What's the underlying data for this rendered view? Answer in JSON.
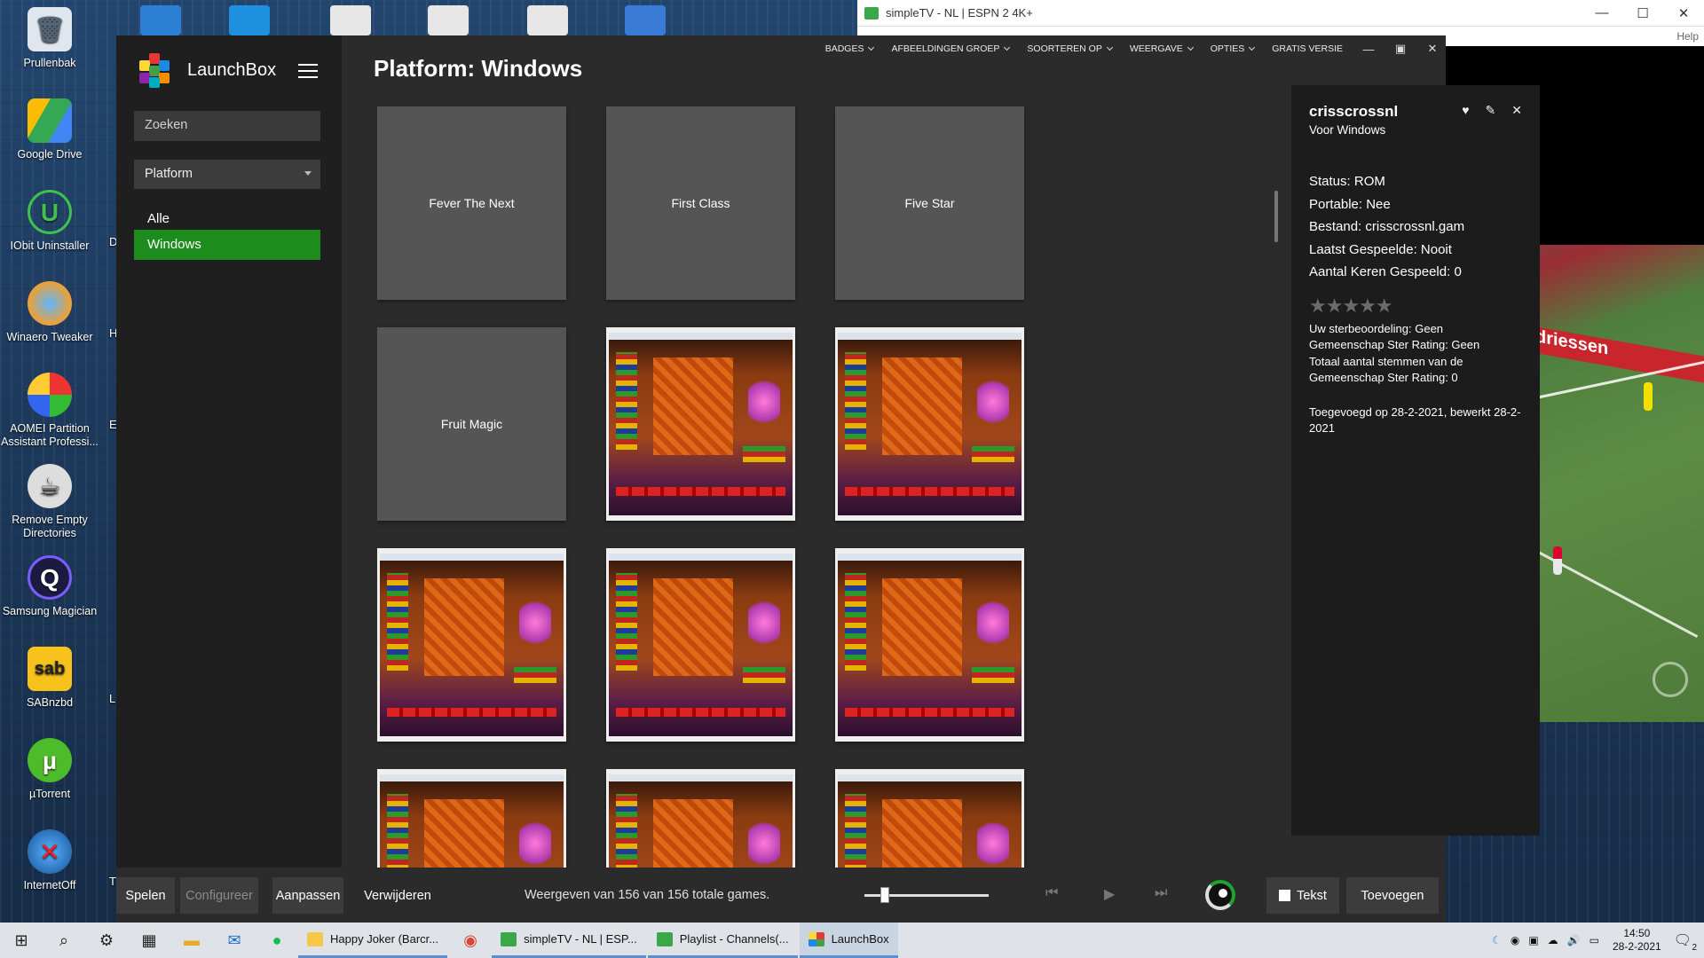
{
  "desktop": {
    "icons": [
      {
        "label": "Prullenbak",
        "icon": "recycle-bin-icon"
      },
      {
        "label": "Google Drive",
        "icon": "google-drive-icon"
      },
      {
        "label": "IObit Uninstaller",
        "icon": "iobit-uninstaller-icon"
      },
      {
        "label": "Winaero Tweaker",
        "icon": "winaero-tweaker-icon"
      },
      {
        "label": "AOMEI Partition Assistant Professi...",
        "icon": "aomei-partition-icon"
      },
      {
        "label": "Remove Empty Directories",
        "icon": "remove-empty-dirs-icon"
      },
      {
        "label": "Samsung Magician",
        "icon": "samsung-magician-icon"
      },
      {
        "label": "SABnzbd",
        "icon": "sabnzbd-icon"
      },
      {
        "label": "µTorrent",
        "icon": "utorrent-icon"
      },
      {
        "label": "InternetOff",
        "icon": "internetoff-icon"
      }
    ],
    "col2_letters": [
      "D",
      "H",
      "E",
      "L",
      "T"
    ]
  },
  "simpletv": {
    "title": "simpleTV - NL | ESPN 2 4K+",
    "menu_help": "Help",
    "pitch_banner": "driessen",
    "colors": {
      "pitch": "#5d8c44",
      "banner": "#c8262d"
    }
  },
  "launchbox": {
    "app_name": "LaunchBox",
    "search_placeholder": "Zoeken",
    "platform_select": "Platform",
    "sidebar_items": [
      "Alle",
      "Windows"
    ],
    "active_item": "Windows",
    "menu": [
      "BADGES",
      "AFBEELDINGEN GROEP",
      "SOORTEREN OP",
      "WEERGAVE",
      "OPTIES"
    ],
    "free_version": "GRATIS VERSIE",
    "page_title": "Platform: Windows",
    "tiles": [
      {
        "label": "Fever The Next",
        "type": "text"
      },
      {
        "label": "First Class",
        "type": "text"
      },
      {
        "label": "Five Star",
        "type": "text"
      },
      {
        "label": "Fruit Magic",
        "type": "text"
      },
      {
        "label": "",
        "type": "screenshot"
      },
      {
        "label": "",
        "type": "screenshot"
      },
      {
        "label": "",
        "type": "screenshot"
      },
      {
        "label": "",
        "type": "screenshot"
      },
      {
        "label": "",
        "type": "screenshot"
      },
      {
        "label": "",
        "type": "screenshot"
      },
      {
        "label": "",
        "type": "screenshot"
      },
      {
        "label": "",
        "type": "screenshot"
      }
    ],
    "detail": {
      "title": "crisscrossnl",
      "subtitle": "Voor Windows",
      "status": "Status: ROM",
      "portable": "Portable: Nee",
      "file": "Bestand: crisscrossnl.gam",
      "last_played": "Laatst Gespeelde: Nooit",
      "play_count": "Aantal Keren Gespeeld: 0",
      "stars": "★★★★★",
      "user_rating": "Uw sterbeoordeling: Geen",
      "community_rating": "Gemeenschap Ster Rating: Geen",
      "total_votes": "Totaal aantal stemmen van de Gemeenschap Ster Rating: 0",
      "added": "Toegevoegd op 28-2-2021, bewerkt 28-2-2021"
    },
    "bottom": {
      "play": "Spelen",
      "configure": "Configureer",
      "edit": "Aanpassen",
      "delete": "Verwijderen",
      "status": "Weergeven van 156 van 156 totale games.",
      "text_toggle": "Tekst",
      "add": "Toevoegen"
    },
    "accent_color": "#1c8c1c"
  },
  "taskbar": {
    "apps": [
      {
        "label": "Happy Joker (Barcr...",
        "color": "#f5c84a"
      },
      {
        "label": "simpleTV - NL | ESP...",
        "color": "#3aa84a"
      },
      {
        "label": "Playlist - Channels(...",
        "color": "#3aa84a"
      },
      {
        "label": "LaunchBox",
        "color": "#c0392b"
      }
    ],
    "time": "14:50",
    "date": "28-2-2021",
    "notifications": "2"
  }
}
